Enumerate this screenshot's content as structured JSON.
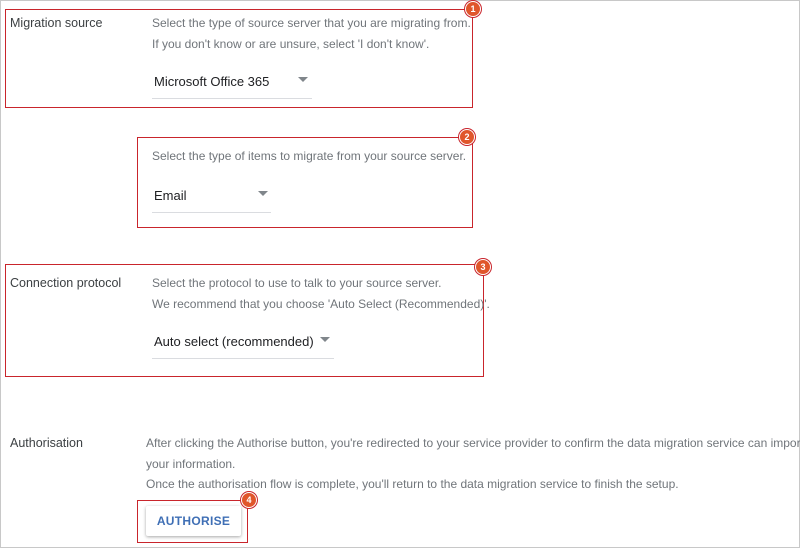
{
  "migration_source": {
    "label": "Migration source",
    "desc_line1": "Select the type of source server that you are migrating from.",
    "desc_line2": "If you don't know or are unsure, select 'I don't know'.",
    "selected": "Microsoft Office 365",
    "badge": "1"
  },
  "items": {
    "desc_line1": "Select the type of items to migrate from your source server.",
    "selected": "Email",
    "badge": "2"
  },
  "connection_protocol": {
    "label": "Connection protocol",
    "desc_line1": "Select the protocol to use to talk to your source server.",
    "desc_line2": "We recommend that you choose 'Auto Select (Recommended)'.",
    "selected": "Auto select (recommended)",
    "badge": "3"
  },
  "authorisation": {
    "label": "Authorisation",
    "desc_line1": "After clicking the Authorise button, you're redirected to your service provider to confirm the data migration service can import",
    "desc_line2": "your information.",
    "desc_line3": "Once the authorisation flow is complete, you'll return to the data migration service to finish the setup.",
    "button_label": "AUTHORISE",
    "badge": "4"
  },
  "colors": {
    "highlight_border": "#c9252c",
    "badge_fill": "#e0562b",
    "button_text": "#3f6fb5"
  }
}
